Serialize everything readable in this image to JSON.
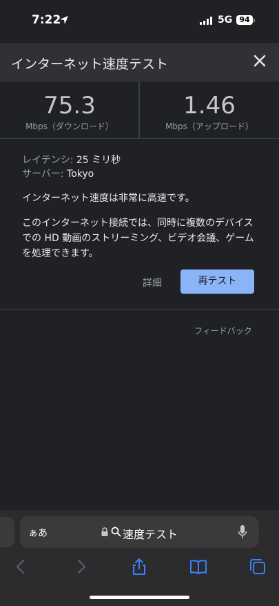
{
  "status_bar": {
    "time": "7:22",
    "network": "5G",
    "battery": "94"
  },
  "header": {
    "title": "インターネット速度テスト"
  },
  "speeds": {
    "download": {
      "value": "75.3",
      "unit": "Mbps（ダウンロード）"
    },
    "upload": {
      "value": "1.46",
      "unit": "Mbps（アップロード）"
    }
  },
  "details": {
    "latency_label": "レイテンシ:",
    "latency_value": "25 ミリ秒",
    "server_label": "サーバー:",
    "server_value": "Tokyo"
  },
  "result_text": "インターネット速度は非常に高速です。",
  "description": "このインターネット接続では、同時に複数のデバイスでの HD 動画のストリーミング、ビデオ会議、ゲームを処理できます。",
  "actions": {
    "details": "詳細",
    "retest": "再テスト"
  },
  "feedback": "フィードバック",
  "browser": {
    "aa_label": "ぁあ",
    "url_text": "速度テスト"
  },
  "colors": {
    "accent": "#8ab4f8",
    "background": "#202124",
    "header": "#303134",
    "safari_blue": "#3a82f7"
  }
}
